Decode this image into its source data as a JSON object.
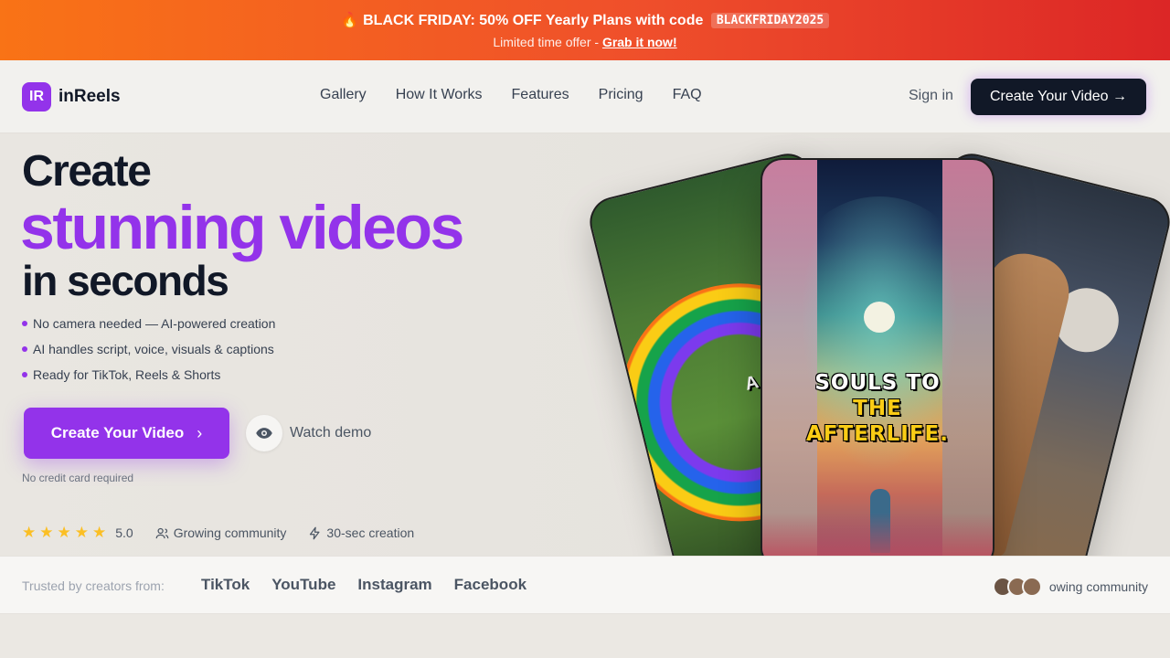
{
  "promo": {
    "fire": "🔥",
    "headline": "BLACK FRIDAY: 50% OFF Yearly Plans with code",
    "code": "BLACKFRIDAY2025",
    "subtext": "Limited time offer - ",
    "link": "Grab it now!"
  },
  "nav": {
    "logo_mark": "IR",
    "logo_text": "inReels",
    "links": [
      "Gallery",
      "How It Works",
      "Features",
      "Pricing",
      "FAQ"
    ],
    "signin": "Sign in",
    "cta": "Create Your Video →"
  },
  "hero": {
    "line1": "Create",
    "line2": "stunning videos",
    "line3": "in seconds",
    "bullets": [
      "No camera needed — AI-powered creation",
      "AI handles script, voice, visuals & captions",
      "Ready for TikTok, Reels & Shorts"
    ],
    "cta": "Create Your Video",
    "cta_chevron": "›",
    "watch_demo": "Watch demo",
    "no_credit_card": "No credit card required",
    "rating_stars": 5,
    "rating": "5.0",
    "stat_community": "Growing community",
    "stat_creation": "30-sec creation"
  },
  "phones": {
    "left_caption": "A ENCH FO",
    "center_caption_line1": "SOULS TO",
    "center_caption_line2": "THE",
    "center_caption_line3": "AFTERLIFE."
  },
  "trusted": {
    "label": "Trusted by creators from:",
    "platforms": [
      "TikTok",
      "YouTube",
      "Instagram",
      "Facebook"
    ],
    "community": "owing community"
  },
  "colors": {
    "accent": "#9333ea",
    "dark": "#111827",
    "star": "#fbbf24"
  }
}
